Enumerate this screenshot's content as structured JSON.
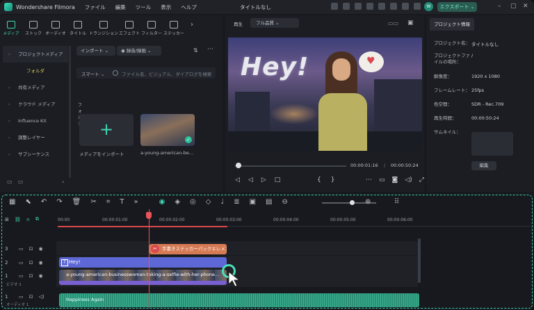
{
  "titlebar": {
    "app_name": "Wondershare Filmora",
    "menu": [
      "ファイル",
      "編集",
      "ツール",
      "表示",
      "ヘルプ"
    ],
    "window_title": "タイトルなし",
    "avatar_letter": "W",
    "export_label": "エクスポート"
  },
  "library": {
    "tabs": [
      "メディア",
      "ストック",
      "オーディオ",
      "タイトル",
      "トランジション",
      "エフェクト",
      "フィルター",
      "ステッカー"
    ],
    "nav": [
      "プロジェクトメディア",
      "フォルダ",
      "共有メディア",
      "クラウド メディア",
      "Influence Kit",
      "調整レイヤー",
      "サブシーケンス"
    ],
    "import_label": "インポート",
    "record_label": "録音/録画",
    "search_mode": "スマート",
    "search_placeholder": "ファイル名、ビジュアル、ダイアログを検索",
    "folder_label": "フォルダ",
    "items": [
      {
        "label": "メディアをインポート"
      },
      {
        "label": "a-young-american-be..."
      }
    ]
  },
  "preview": {
    "mode_label": "再生",
    "quality": "フル品質",
    "overlay_text": "Hey!",
    "current_time": "00:00:01:16",
    "total_time": "00:00:50:24",
    "progress": 0.03
  },
  "info": {
    "tab": "プロジェクト情報",
    "rows": [
      {
        "label": "プロジェクト名：",
        "value": "タイトルなし"
      },
      {
        "label": "プロジェクトファイルの場所：",
        "value": "/"
      },
      {
        "label": "解像度：",
        "value": "1920 x 1080"
      },
      {
        "label": "フレームレート：",
        "value": "25fps"
      },
      {
        "label": "色空間：",
        "value": "SDR - Rec.709"
      },
      {
        "label": "再生時間：",
        "value": "00:00:50:24"
      },
      {
        "label": "サムネイル：",
        "value": ""
      }
    ],
    "edit_label": "編集"
  },
  "timeline": {
    "ruler": [
      "00:00",
      "00:00:01:00",
      "00:00:02:00",
      "00:00:03:00",
      "00:00:04:00",
      "00:00:05:00",
      "00:00:06:00"
    ],
    "tracks": [
      {
        "num": "3",
        "label": ""
      },
      {
        "num": "2",
        "label": ""
      },
      {
        "num": "1",
        "label": "ビデオ 1"
      },
      {
        "num": "1",
        "label": "オーディオ 1"
      }
    ],
    "sticker_clip": "手書きステッカーパックエレメン...",
    "text_clip": "Hey!",
    "video_clip": "a-young-american-businesswoman-taking-a-selfie-with-her-phone...",
    "audio_clip": "Happiness Again"
  },
  "colors": {
    "accent": "#41d6b2",
    "playhead": "#e9545a",
    "text_clip": "#5d68d6",
    "sticker_clip": "#d67a54",
    "audio_clip": "#2a8f75"
  }
}
